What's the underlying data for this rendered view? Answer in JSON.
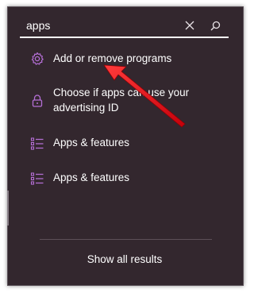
{
  "search": {
    "value": "apps",
    "clear_icon": "close-icon",
    "search_icon": "search-icon"
  },
  "results": [
    {
      "label": "Add or remove programs",
      "icon": "gear-icon"
    },
    {
      "label": "Choose if apps can use your advertising ID",
      "icon": "lock-icon"
    },
    {
      "label": "Apps & features",
      "icon": "list-icon"
    },
    {
      "label": "Apps & features",
      "icon": "list-icon"
    }
  ],
  "footer": {
    "show_all_label": "Show all results"
  },
  "annotation": {
    "arrow_color": "#e8101a",
    "arrow_icon": "red-arrow-pointer"
  },
  "colors": {
    "panel_bg": "#33272e",
    "icon_accent": "#b56fd6",
    "text": "#ffffff"
  }
}
